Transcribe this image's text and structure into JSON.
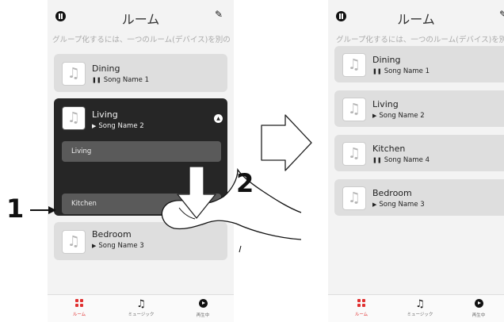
{
  "header": {
    "title": "ルーム"
  },
  "hint": "グループ化するには、一つのルーム(デバイス)を別の",
  "left": {
    "rooms": [
      {
        "room": "Dining",
        "state": "❚❚",
        "song": "Song Name 1"
      },
      {
        "room": "Living",
        "state": "▶",
        "song": "Song Name 2"
      },
      {
        "room": "Bedroom",
        "state": "▶",
        "song": "Song Name 3"
      }
    ],
    "sub_items": [
      "Living",
      "Kitchen"
    ]
  },
  "right": {
    "rooms": [
      {
        "room": "Dining",
        "state": "❚❚",
        "song": "Song Name 1"
      },
      {
        "room": "Living",
        "state": "▶",
        "song": "Song Name 2"
      },
      {
        "room": "Kitchen",
        "state": "❚❚",
        "song": "Song Name 4"
      },
      {
        "room": "Bedroom",
        "state": "▶",
        "song": "Song Name 3"
      }
    ]
  },
  "tabs": [
    "ルーム",
    "ミュージック",
    "再生中"
  ],
  "callouts": {
    "step1": "1",
    "step2": "2"
  },
  "icons": [
    "pause-icon",
    "edit-icon",
    "music-note-icon",
    "collapse-icon",
    "rooms-icon",
    "music-icon",
    "now-playing-icon",
    "hand-pointer",
    "arrow-down-icon",
    "arrow-right-icon"
  ],
  "colors": {
    "accent": "#e03030",
    "expanded_card": "#262626",
    "sub_item": "#5a5a5a",
    "card": "#dedede",
    "screen": "#f3f3f3"
  }
}
